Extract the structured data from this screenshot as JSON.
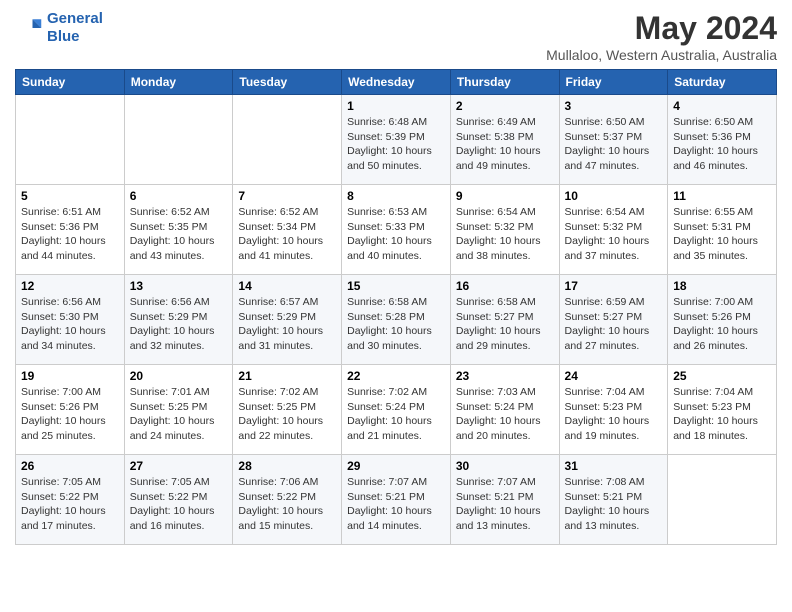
{
  "header": {
    "logo_line1": "General",
    "logo_line2": "Blue",
    "month": "May 2024",
    "location": "Mullaloo, Western Australia, Australia"
  },
  "days_of_week": [
    "Sunday",
    "Monday",
    "Tuesday",
    "Wednesday",
    "Thursday",
    "Friday",
    "Saturday"
  ],
  "weeks": [
    [
      {
        "day": "",
        "info": ""
      },
      {
        "day": "",
        "info": ""
      },
      {
        "day": "",
        "info": ""
      },
      {
        "day": "1",
        "info": "Sunrise: 6:48 AM\nSunset: 5:39 PM\nDaylight: 10 hours\nand 50 minutes."
      },
      {
        "day": "2",
        "info": "Sunrise: 6:49 AM\nSunset: 5:38 PM\nDaylight: 10 hours\nand 49 minutes."
      },
      {
        "day": "3",
        "info": "Sunrise: 6:50 AM\nSunset: 5:37 PM\nDaylight: 10 hours\nand 47 minutes."
      },
      {
        "day": "4",
        "info": "Sunrise: 6:50 AM\nSunset: 5:36 PM\nDaylight: 10 hours\nand 46 minutes."
      }
    ],
    [
      {
        "day": "5",
        "info": "Sunrise: 6:51 AM\nSunset: 5:36 PM\nDaylight: 10 hours\nand 44 minutes."
      },
      {
        "day": "6",
        "info": "Sunrise: 6:52 AM\nSunset: 5:35 PM\nDaylight: 10 hours\nand 43 minutes."
      },
      {
        "day": "7",
        "info": "Sunrise: 6:52 AM\nSunset: 5:34 PM\nDaylight: 10 hours\nand 41 minutes."
      },
      {
        "day": "8",
        "info": "Sunrise: 6:53 AM\nSunset: 5:33 PM\nDaylight: 10 hours\nand 40 minutes."
      },
      {
        "day": "9",
        "info": "Sunrise: 6:54 AM\nSunset: 5:32 PM\nDaylight: 10 hours\nand 38 minutes."
      },
      {
        "day": "10",
        "info": "Sunrise: 6:54 AM\nSunset: 5:32 PM\nDaylight: 10 hours\nand 37 minutes."
      },
      {
        "day": "11",
        "info": "Sunrise: 6:55 AM\nSunset: 5:31 PM\nDaylight: 10 hours\nand 35 minutes."
      }
    ],
    [
      {
        "day": "12",
        "info": "Sunrise: 6:56 AM\nSunset: 5:30 PM\nDaylight: 10 hours\nand 34 minutes."
      },
      {
        "day": "13",
        "info": "Sunrise: 6:56 AM\nSunset: 5:29 PM\nDaylight: 10 hours\nand 32 minutes."
      },
      {
        "day": "14",
        "info": "Sunrise: 6:57 AM\nSunset: 5:29 PM\nDaylight: 10 hours\nand 31 minutes."
      },
      {
        "day": "15",
        "info": "Sunrise: 6:58 AM\nSunset: 5:28 PM\nDaylight: 10 hours\nand 30 minutes."
      },
      {
        "day": "16",
        "info": "Sunrise: 6:58 AM\nSunset: 5:27 PM\nDaylight: 10 hours\nand 29 minutes."
      },
      {
        "day": "17",
        "info": "Sunrise: 6:59 AM\nSunset: 5:27 PM\nDaylight: 10 hours\nand 27 minutes."
      },
      {
        "day": "18",
        "info": "Sunrise: 7:00 AM\nSunset: 5:26 PM\nDaylight: 10 hours\nand 26 minutes."
      }
    ],
    [
      {
        "day": "19",
        "info": "Sunrise: 7:00 AM\nSunset: 5:26 PM\nDaylight: 10 hours\nand 25 minutes."
      },
      {
        "day": "20",
        "info": "Sunrise: 7:01 AM\nSunset: 5:25 PM\nDaylight: 10 hours\nand 24 minutes."
      },
      {
        "day": "21",
        "info": "Sunrise: 7:02 AM\nSunset: 5:25 PM\nDaylight: 10 hours\nand 22 minutes."
      },
      {
        "day": "22",
        "info": "Sunrise: 7:02 AM\nSunset: 5:24 PM\nDaylight: 10 hours\nand 21 minutes."
      },
      {
        "day": "23",
        "info": "Sunrise: 7:03 AM\nSunset: 5:24 PM\nDaylight: 10 hours\nand 20 minutes."
      },
      {
        "day": "24",
        "info": "Sunrise: 7:04 AM\nSunset: 5:23 PM\nDaylight: 10 hours\nand 19 minutes."
      },
      {
        "day": "25",
        "info": "Sunrise: 7:04 AM\nSunset: 5:23 PM\nDaylight: 10 hours\nand 18 minutes."
      }
    ],
    [
      {
        "day": "26",
        "info": "Sunrise: 7:05 AM\nSunset: 5:22 PM\nDaylight: 10 hours\nand 17 minutes."
      },
      {
        "day": "27",
        "info": "Sunrise: 7:05 AM\nSunset: 5:22 PM\nDaylight: 10 hours\nand 16 minutes."
      },
      {
        "day": "28",
        "info": "Sunrise: 7:06 AM\nSunset: 5:22 PM\nDaylight: 10 hours\nand 15 minutes."
      },
      {
        "day": "29",
        "info": "Sunrise: 7:07 AM\nSunset: 5:21 PM\nDaylight: 10 hours\nand 14 minutes."
      },
      {
        "day": "30",
        "info": "Sunrise: 7:07 AM\nSunset: 5:21 PM\nDaylight: 10 hours\nand 13 minutes."
      },
      {
        "day": "31",
        "info": "Sunrise: 7:08 AM\nSunset: 5:21 PM\nDaylight: 10 hours\nand 13 minutes."
      },
      {
        "day": "",
        "info": ""
      }
    ]
  ]
}
